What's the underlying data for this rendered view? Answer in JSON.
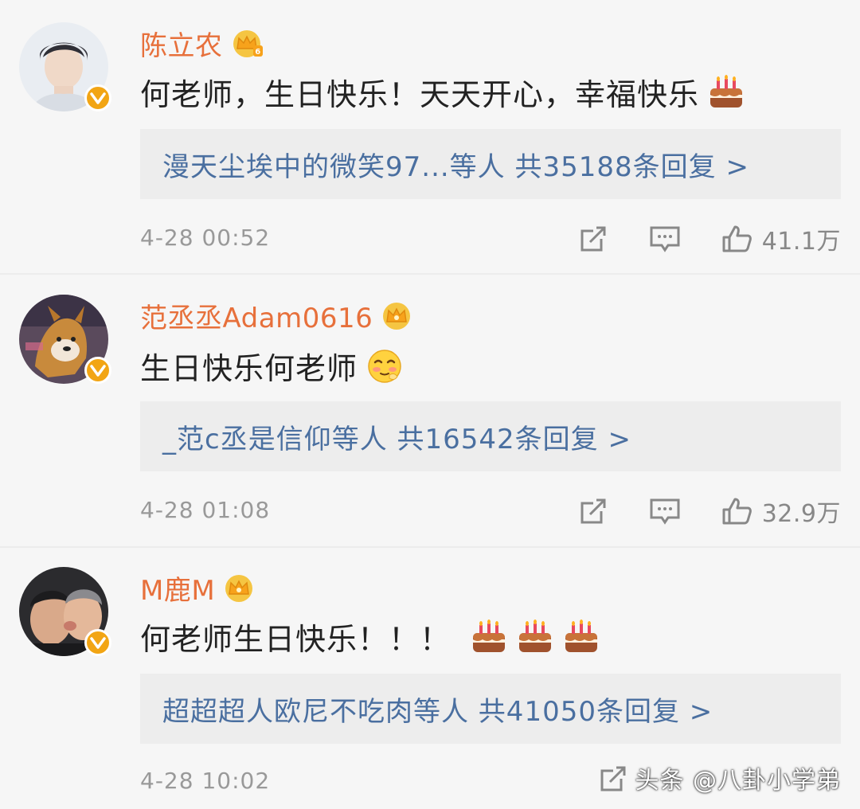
{
  "comments": [
    {
      "username": "陈立农",
      "text": "何老师，生日快乐！天天开心，幸福快乐",
      "emoji": [
        "cake-icon"
      ],
      "replies": "漫天尘埃中的微笑97...等人 共35188条回复 >",
      "timestamp": "4-28 00:52",
      "likes": "41.1万"
    },
    {
      "username": "范丞丞Adam0616",
      "text": "生日快乐何老师",
      "emoji": [
        "blush-face-icon"
      ],
      "replies": "_范c丞是信仰等人 共16542条回复 >",
      "timestamp": "4-28 01:08",
      "likes": "32.9万"
    },
    {
      "username": "M鹿M",
      "text": "何老师生日快乐！！！",
      "emoji": [
        "cake-icon",
        "cake-icon",
        "cake-icon"
      ],
      "replies": "超超超人欧尼不吃肉等人 共41050条回复 >",
      "timestamp": "4-28 10:02",
      "likes": ""
    }
  ],
  "watermark": "头条 @八卦小学弟",
  "colors": {
    "username": "#e7703b",
    "reply_link": "#4a6fa0",
    "meta": "#999999",
    "verified_badge": "#f2a514",
    "reply_bg": "#ededed",
    "background": "#f6f6f6"
  }
}
